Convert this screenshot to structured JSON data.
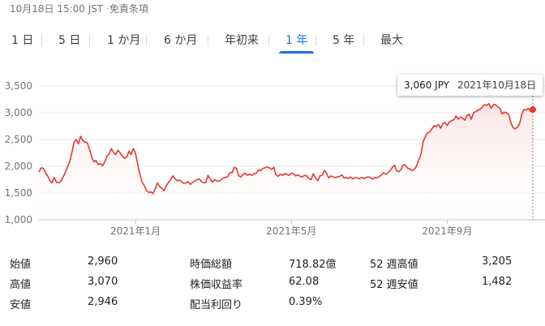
{
  "header": {
    "timestamp": "10月18日 15:00 JST ·免責条項"
  },
  "range_tabs": [
    {
      "label": "1 日"
    },
    {
      "label": "5 日"
    },
    {
      "label": "1 か月"
    },
    {
      "label": "6 か月"
    },
    {
      "label": "年初来"
    },
    {
      "label": "1 年",
      "selected": true
    },
    {
      "label": "5 年"
    },
    {
      "label": "最大"
    }
  ],
  "tooltip": {
    "price": "3,060 JPY",
    "date": "2021年10月18日"
  },
  "colors": {
    "line": "#e53935",
    "accent": "#1a73e8",
    "fill_top": "#fbe3e1"
  },
  "chart_data": {
    "type": "area",
    "ylim": [
      1000,
      3500
    ],
    "yticks": [
      "1,000",
      "1,500",
      "2,000",
      "2,500",
      "3,000",
      "3,500"
    ],
    "ytick_values": [
      1000,
      1500,
      2000,
      2500,
      3000,
      3500
    ],
    "xticks": [
      {
        "label": "2021年1月",
        "index": 44
      },
      {
        "label": "2021年5月",
        "index": 115
      },
      {
        "label": "2021年9月",
        "index": 186
      }
    ],
    "grid": true,
    "series": [
      {
        "values": [
          1890,
          1970,
          1960,
          1880,
          1820,
          1730,
          1690,
          1790,
          1700,
          1690,
          1720,
          1800,
          1880,
          1990,
          2080,
          2250,
          2450,
          2500,
          2420,
          2560,
          2480,
          2450,
          2440,
          2320,
          2180,
          2080,
          2110,
          2030,
          2050,
          2010,
          2080,
          2190,
          2230,
          2330,
          2260,
          2220,
          2300,
          2250,
          2190,
          2150,
          2170,
          2280,
          2220,
          2330,
          2240,
          2040,
          1850,
          1700,
          1640,
          1550,
          1510,
          1520,
          1490,
          1580,
          1690,
          1620,
          1590,
          1540,
          1630,
          1700,
          1750,
          1820,
          1770,
          1730,
          1740,
          1710,
          1680,
          1690,
          1710,
          1660,
          1700,
          1720,
          1750,
          1760,
          1720,
          1690,
          1700,
          1830,
          1760,
          1700,
          1750,
          1730,
          1720,
          1750,
          1780,
          1790,
          1810,
          1880,
          1880,
          1980,
          1960,
          1820,
          1800,
          1850,
          1870,
          1830,
          1850,
          1830,
          1860,
          1870,
          1930,
          1920,
          1960,
          1970,
          1990,
          1970,
          1940,
          1980,
          1840,
          1810,
          1850,
          1830,
          1860,
          1850,
          1830,
          1870,
          1860,
          1820,
          1840,
          1810,
          1800,
          1830,
          1820,
          1770,
          1750,
          1860,
          1780,
          1730,
          1820,
          1830,
          1920,
          1870,
          1780,
          1820,
          1800,
          1790,
          1800,
          1810,
          1840,
          1780,
          1790,
          1770,
          1800,
          1760,
          1790,
          1780,
          1770,
          1790,
          1770,
          1790,
          1800,
          1790,
          1760,
          1790,
          1780,
          1810,
          1830,
          1880,
          1850,
          1880,
          1920,
          1980,
          2020,
          1910,
          1900,
          1940,
          2030,
          2020,
          1960,
          1950,
          1920,
          1940,
          2000,
          2120,
          2220,
          2460,
          2550,
          2620,
          2640,
          2700,
          2760,
          2740,
          2780,
          2710,
          2800,
          2820,
          2760,
          2830,
          2850,
          2870,
          2940,
          2880,
          2920,
          2900,
          2860,
          2950,
          2970,
          2880,
          3000,
          3020,
          3050,
          3060,
          3110,
          3150,
          3140,
          3170,
          3080,
          3150,
          3150,
          3110,
          3080,
          2980,
          3010,
          3000,
          2970,
          2820,
          2720,
          2700,
          2730,
          2800,
          2980,
          3060,
          3050,
          3080,
          3020,
          3060
        ]
      }
    ]
  },
  "stats": [
    {
      "label": "始値",
      "value": "2,960"
    },
    {
      "label": "高値",
      "value": "3,070"
    },
    {
      "label": "安値",
      "value": "2,946"
    },
    {
      "label": "時価総額",
      "value": "718.82億"
    },
    {
      "label": "株価収益率",
      "value": "62.08"
    },
    {
      "label": "配当利回り",
      "value": "0.39%"
    },
    {
      "label": "52 週高値",
      "value": "3,205"
    },
    {
      "label": "52 週安値",
      "value": "1,482"
    }
  ]
}
